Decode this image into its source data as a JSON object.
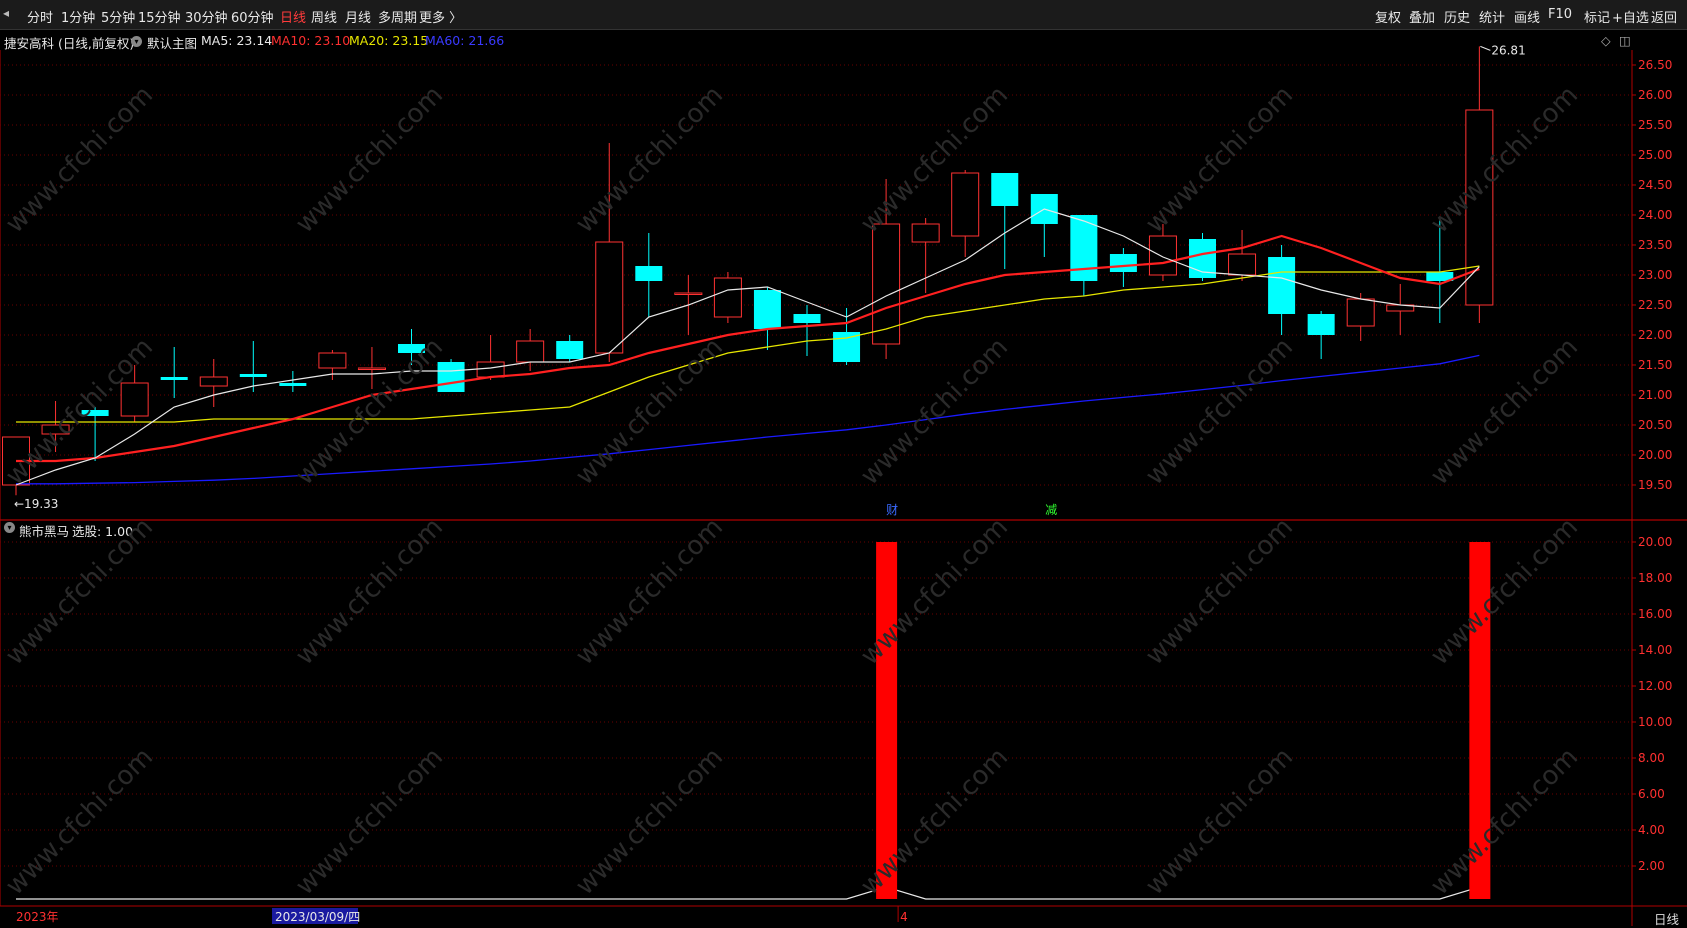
{
  "toolbar": {
    "left": [
      "分时",
      "1分钟",
      "5分钟",
      "15分钟",
      "30分钟",
      "60分钟",
      "日线",
      "周线",
      "月线",
      "多周期",
      "更多 〉"
    ],
    "active": "日线",
    "right": [
      "复权",
      "叠加",
      "历史",
      "统计",
      "画线",
      "F10",
      "标记",
      "+自选",
      "返回"
    ]
  },
  "main_title": {
    "stock": "捷安高科 (日线,前复权)",
    "template": "默认主图",
    "ma5": "MA5: 23.14",
    "ma10": "MA10: 23.10",
    "ma20": "MA20: 23.15",
    "ma60": "MA60: 21.66"
  },
  "indicator_title": {
    "name": "熊市黑马",
    "value": "选股: 1.00"
  },
  "markers": {
    "cai": "财",
    "jian": "减"
  },
  "colors": {
    "up": "#ff3232",
    "down": "#00ffff",
    "ma5": "#e8e8e8",
    "ma10": "#ff2020",
    "ma20": "#e6e600",
    "ma60": "#1a1aff",
    "axis": "#b00000"
  },
  "chart_data": [
    {
      "type": "candlestick",
      "price_axis": {
        "ticks": [
          "26.50",
          "26.00",
          "25.50",
          "25.00",
          "24.50",
          "24.00",
          "23.50",
          "23.00",
          "22.50",
          "22.00",
          "21.50",
          "21.00",
          "20.50",
          "20.00",
          "19.50"
        ],
        "ylim": [
          19.33,
          26.81
        ]
      },
      "high_label": "26.81",
      "low_label": "19.33",
      "candles": [
        {
          "o": 19.5,
          "h": 20.3,
          "l": 19.33,
          "c": 20.3
        },
        {
          "o": 20.35,
          "h": 20.9,
          "l": 20.05,
          "c": 20.5
        },
        {
          "o": 20.75,
          "h": 20.8,
          "l": 19.9,
          "c": 20.65
        },
        {
          "o": 20.65,
          "h": 21.5,
          "l": 20.55,
          "c": 21.2
        },
        {
          "o": 21.3,
          "h": 21.8,
          "l": 20.95,
          "c": 21.25
        },
        {
          "o": 21.15,
          "h": 21.6,
          "l": 20.8,
          "c": 21.3
        },
        {
          "o": 21.35,
          "h": 21.9,
          "l": 21.05,
          "c": 21.3
        },
        {
          "o": 21.2,
          "h": 21.4,
          "l": 21.05,
          "c": 21.15
        },
        {
          "o": 21.45,
          "h": 21.75,
          "l": 21.25,
          "c": 21.7
        },
        {
          "o": 21.45,
          "h": 21.8,
          "l": 21.1,
          "c": 21.45
        },
        {
          "o": 21.85,
          "h": 22.1,
          "l": 21.5,
          "c": 21.7
        },
        {
          "o": 21.55,
          "h": 21.6,
          "l": 21.05,
          "c": 21.05
        },
        {
          "o": 21.3,
          "h": 22.0,
          "l": 21.25,
          "c": 21.55
        },
        {
          "o": 21.55,
          "h": 22.1,
          "l": 21.4,
          "c": 21.9
        },
        {
          "o": 21.9,
          "h": 22.0,
          "l": 21.55,
          "c": 21.6
        },
        {
          "o": 21.7,
          "h": 25.2,
          "l": 21.55,
          "c": 23.55
        },
        {
          "o": 23.15,
          "h": 23.7,
          "l": 22.3,
          "c": 22.9
        },
        {
          "o": 22.7,
          "h": 23.0,
          "l": 22.0,
          "c": 22.7
        },
        {
          "o": 22.3,
          "h": 23.05,
          "l": 22.2,
          "c": 22.95
        },
        {
          "o": 22.75,
          "h": 22.8,
          "l": 21.75,
          "c": 22.1
        },
        {
          "o": 22.35,
          "h": 22.5,
          "l": 21.65,
          "c": 22.2
        },
        {
          "o": 22.05,
          "h": 22.45,
          "l": 21.5,
          "c": 21.55
        },
        {
          "o": 21.85,
          "h": 24.6,
          "l": 21.6,
          "c": 23.85
        },
        {
          "o": 23.55,
          "h": 23.95,
          "l": 22.7,
          "c": 23.85
        },
        {
          "o": 23.65,
          "h": 24.75,
          "l": 23.3,
          "c": 24.7
        },
        {
          "o": 24.7,
          "h": 24.7,
          "l": 23.1,
          "c": 24.15
        },
        {
          "o": 24.35,
          "h": 24.35,
          "l": 23.3,
          "c": 23.85
        },
        {
          "o": 24.0,
          "h": 24.0,
          "l": 22.65,
          "c": 22.9
        },
        {
          "o": 23.35,
          "h": 23.45,
          "l": 22.8,
          "c": 23.05
        },
        {
          "o": 23.0,
          "h": 23.85,
          "l": 22.9,
          "c": 23.65
        },
        {
          "o": 23.6,
          "h": 23.7,
          "l": 22.9,
          "c": 22.95
        },
        {
          "o": 23.0,
          "h": 23.75,
          "l": 22.9,
          "c": 23.35
        },
        {
          "o": 23.3,
          "h": 23.5,
          "l": 22.0,
          "c": 22.35
        },
        {
          "o": 22.35,
          "h": 22.4,
          "l": 21.6,
          "c": 22.0
        },
        {
          "o": 22.15,
          "h": 22.7,
          "l": 21.9,
          "c": 22.6
        },
        {
          "o": 22.4,
          "h": 22.85,
          "l": 22.0,
          "c": 22.5
        },
        {
          "o": 23.05,
          "h": 23.95,
          "l": 22.2,
          "c": 22.9
        },
        {
          "o": 22.5,
          "h": 26.81,
          "l": 22.2,
          "c": 25.75
        }
      ],
      "ma5": [
        19.5,
        19.75,
        19.95,
        20.35,
        20.8,
        21.0,
        21.15,
        21.25,
        21.35,
        21.35,
        21.4,
        21.4,
        21.45,
        21.55,
        21.55,
        21.7,
        22.3,
        22.5,
        22.75,
        22.8,
        22.55,
        22.3,
        22.65,
        22.95,
        23.25,
        23.7,
        24.1,
        23.9,
        23.65,
        23.3,
        23.05,
        23.0,
        22.95,
        22.75,
        22.6,
        22.5,
        22.45,
        23.14
      ],
      "ma10": [
        19.9,
        19.9,
        19.95,
        20.05,
        20.15,
        20.3,
        20.45,
        20.6,
        20.8,
        21.0,
        21.1,
        21.2,
        21.3,
        21.35,
        21.45,
        21.5,
        21.7,
        21.85,
        22.0,
        22.1,
        22.15,
        22.2,
        22.45,
        22.65,
        22.85,
        23.0,
        23.05,
        23.1,
        23.15,
        23.2,
        23.35,
        23.45,
        23.65,
        23.45,
        23.2,
        22.95,
        22.85,
        23.1
      ],
      "ma20": [
        20.55,
        20.55,
        20.55,
        20.55,
        20.55,
        20.6,
        20.6,
        20.6,
        20.6,
        20.6,
        20.6,
        20.65,
        20.7,
        20.75,
        20.8,
        21.05,
        21.3,
        21.5,
        21.7,
        21.8,
        21.9,
        21.95,
        22.1,
        22.3,
        22.4,
        22.5,
        22.6,
        22.65,
        22.75,
        22.8,
        22.85,
        22.95,
        23.05,
        23.05,
        23.05,
        23.05,
        23.05,
        23.15
      ],
      "ma60": [
        19.52,
        19.52,
        19.53,
        19.54,
        19.56,
        19.58,
        19.61,
        19.65,
        19.69,
        19.73,
        19.77,
        19.81,
        19.85,
        19.9,
        19.96,
        20.02,
        20.09,
        20.16,
        20.23,
        20.3,
        20.36,
        20.42,
        20.5,
        20.59,
        20.68,
        20.76,
        20.83,
        20.9,
        20.96,
        21.02,
        21.09,
        21.16,
        21.24,
        21.31,
        21.38,
        21.45,
        21.52,
        21.66
      ]
    },
    {
      "type": "bar",
      "name": "熊市黑马",
      "y_axis": {
        "ticks": [
          "20.00",
          "18.00",
          "16.00",
          "14.00",
          "12.00",
          "10.00",
          "8.00",
          "6.00",
          "4.00",
          "2.00"
        ],
        "ylim": [
          0,
          20
        ]
      },
      "signal_index": [
        22,
        37
      ],
      "bar_value": 20,
      "line_peak_value": 1
    }
  ],
  "x_axis": {
    "start_label": "2023年",
    "cursor_date": "2023/03/09/四",
    "month_label": "4"
  },
  "period_label": "日线"
}
